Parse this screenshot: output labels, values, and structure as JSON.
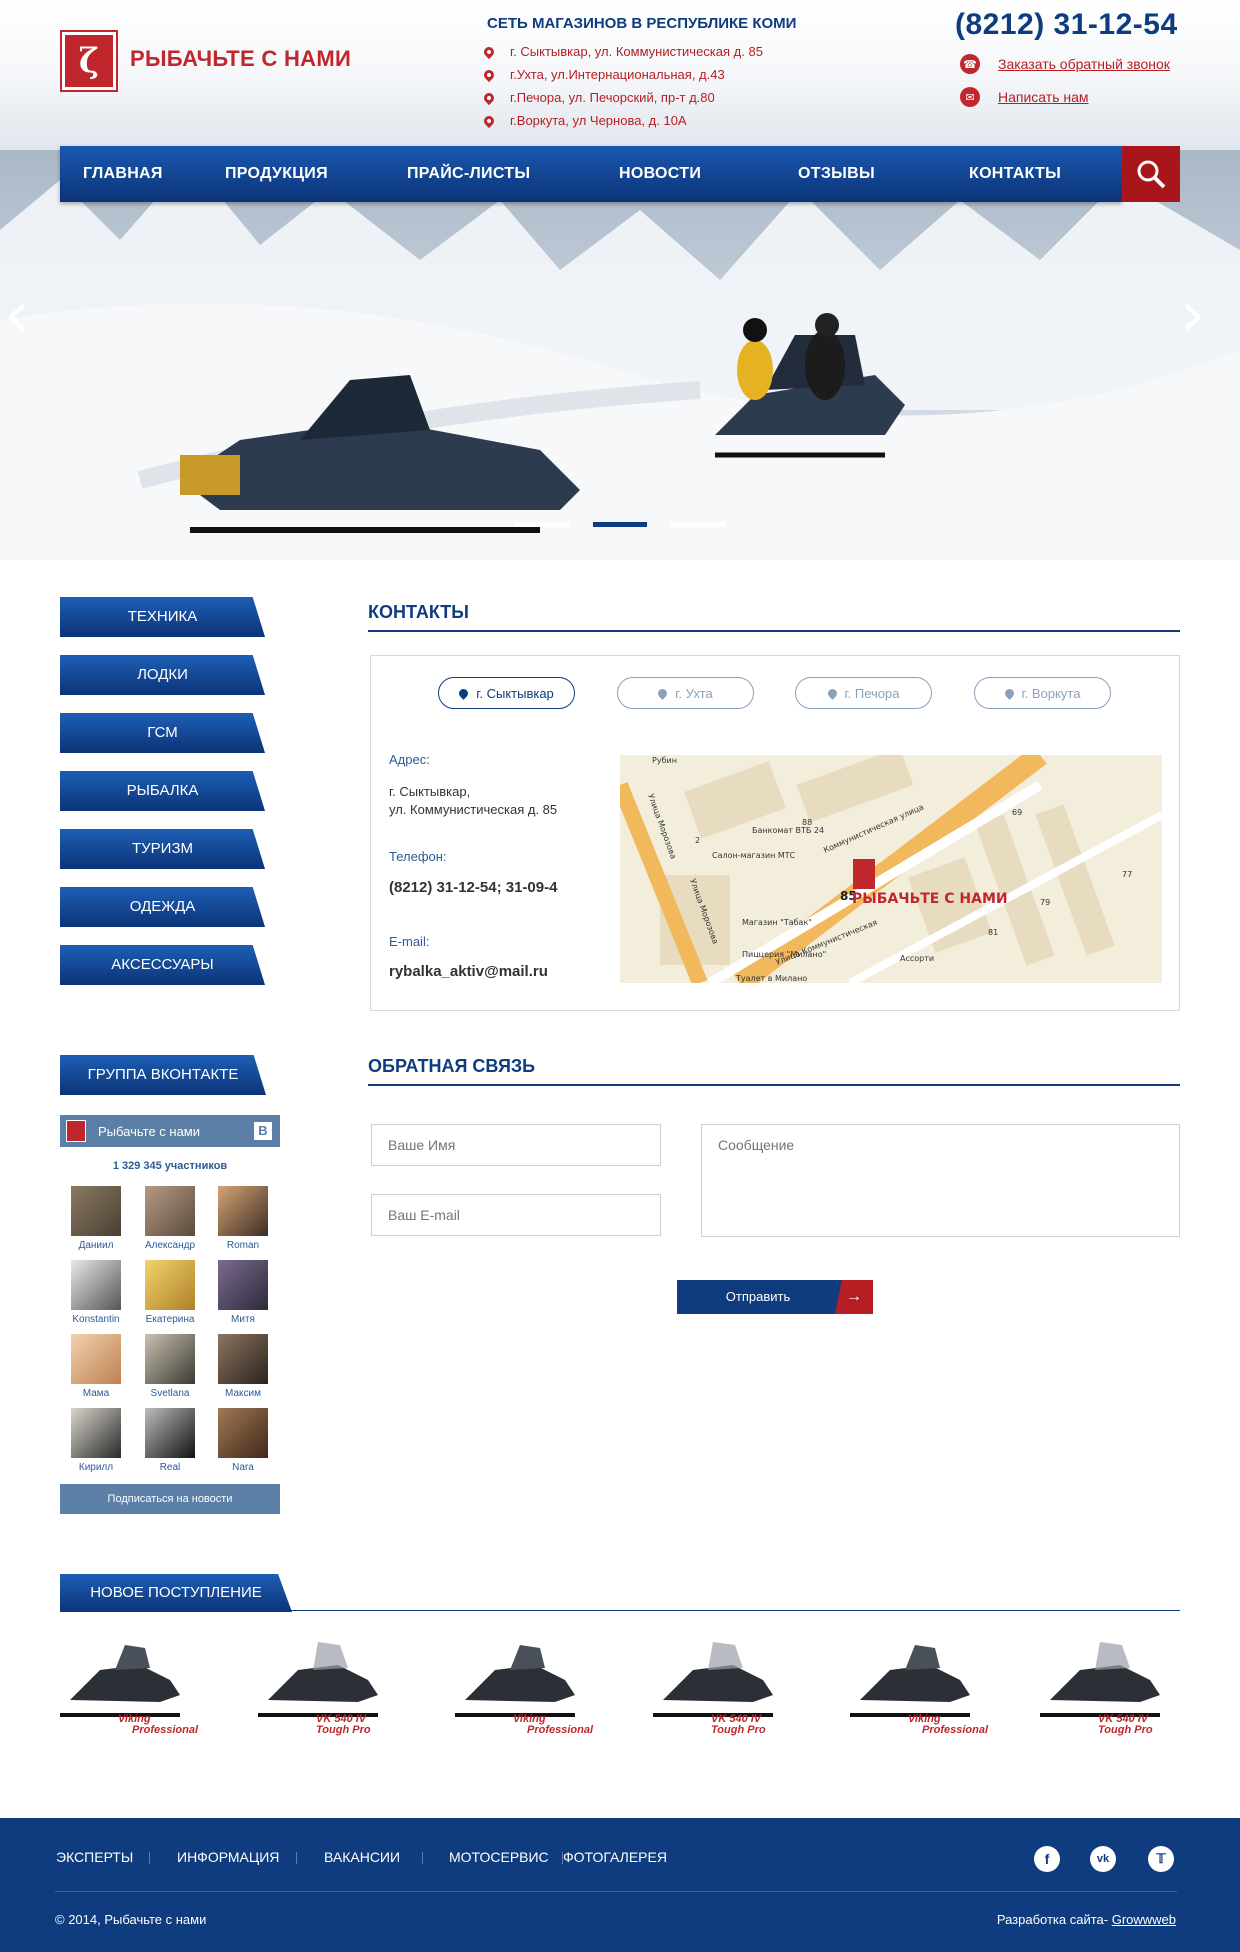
{
  "header": {
    "logo_text": "РЫБАЧЬТЕ С НАМИ",
    "network_title": "СЕТЬ МАГАЗИНОВ В РЕСПУБЛИКЕ КОМИ",
    "addresses": [
      "г. Сыктывкар, ул. Коммунистическая д. 85",
      "г.Ухта, ул.Интернациональная, д.43",
      "г.Печора,  ул. Печорский, пр-т  д.80",
      "г.Воркута,  ул Чернова,  д. 10А"
    ],
    "phone": "(8212) 31-12-54",
    "callback_link": "Заказать обратный звонок",
    "write_link": "Написать нам"
  },
  "nav": {
    "items": [
      "ГЛАВНАЯ",
      "ПРОДУКЦИЯ",
      "ПРАЙС-ЛИСТЫ",
      "НОВОСТИ",
      "ОТЗЫВЫ",
      "КОНТАКТЫ"
    ]
  },
  "slider": {
    "active_dot": 2,
    "dot_count": 3
  },
  "sidebar": {
    "categories": [
      "ТЕХНИКА",
      "ЛОДКИ",
      "ГСМ",
      "РЫБАЛКА",
      "ТУРИЗМ",
      "ОДЕЖДА",
      "АКСЕССУАРЫ"
    ],
    "vk": {
      "title": "ГРУППА ВКОНТАКТЕ",
      "group_name": "Рыбачьте с нами",
      "vk_letter": "B",
      "members_count": "1 329 345 участников",
      "members": [
        "Даниил",
        "Александр",
        "Roman",
        "Konstantin",
        "Екатерина",
        "Митя",
        "Мама",
        "Svetlana",
        "Максим",
        "Кирилл",
        "Real",
        "Nara"
      ],
      "subscribe": "Подписаться на новости"
    }
  },
  "contacts": {
    "title": "КОНТАКТЫ",
    "cities": [
      "г. Сыктывкар",
      "г. Ухта",
      "г. Печора",
      "г. Воркута"
    ],
    "active_city": 0,
    "address_label": "Адрес:",
    "address_line1": "г. Сыктывкар,",
    "address_line2": "ул. Коммунистическая д. 85",
    "phone_label": "Телефон:",
    "phone": "(8212) 31-12-54; 31-09-4",
    "email_label": "E-mail:",
    "email": "rybalka_aktiv@mail.ru",
    "map": {
      "marker_label": "РЫБАЧЬТЕ С НАМИ",
      "house_number": "85",
      "labels": [
        "Рубин",
        "Улица Морозова",
        "Банкомат ВТБ 24",
        "Салон-магазин МТС",
        "Коммунистическая улица",
        "Улица Коммунистическая",
        "Магазин \"Табак\"",
        "Пиццерия \"Милано\"",
        "Ассорти",
        "Туалет в Милано",
        "69",
        "77",
        "79",
        "81",
        "88",
        "2",
        "Улица Морозова"
      ]
    }
  },
  "feedback": {
    "title": "ОБРАТНАЯ СВЯЗЬ",
    "name_placeholder": "Ваше Имя",
    "email_placeholder": "Ваш E-mail",
    "message_placeholder": "Сообщение",
    "send_label": "Отправить"
  },
  "new_arrivals": {
    "title": "НОВОЕ ПОСТУПЛЕНИЕ",
    "products": [
      {
        "label1": "Viking",
        "label2": "Professional"
      },
      {
        "label1": "VK 540 IV",
        "label2": "Tough Pro"
      },
      {
        "label1": "Viking",
        "label2": "Professional"
      },
      {
        "label1": "VK 540 IV",
        "label2": "Tough Pro"
      },
      {
        "label1": "Viking",
        "label2": "Professional"
      },
      {
        "label1": "VK 540 IV",
        "label2": "Tough Pro"
      }
    ]
  },
  "footer": {
    "links": [
      "ЭКСПЕРТЫ",
      "ИНФОРМАЦИЯ",
      "ВАКАНСИИ",
      "МОТОСЕРВИС",
      "ФОТОГАЛЕРЕЯ"
    ],
    "copyright": "© 2014, Рыбачьте с нами",
    "dev_prefix": "Разработка сайта- ",
    "dev_name": "Growwweb",
    "social": [
      "facebook-icon",
      "vk-icon",
      "twitter-icon"
    ]
  },
  "colors": {
    "brand_red": "#c0272d",
    "brand_blue": "#0e3c7e"
  }
}
